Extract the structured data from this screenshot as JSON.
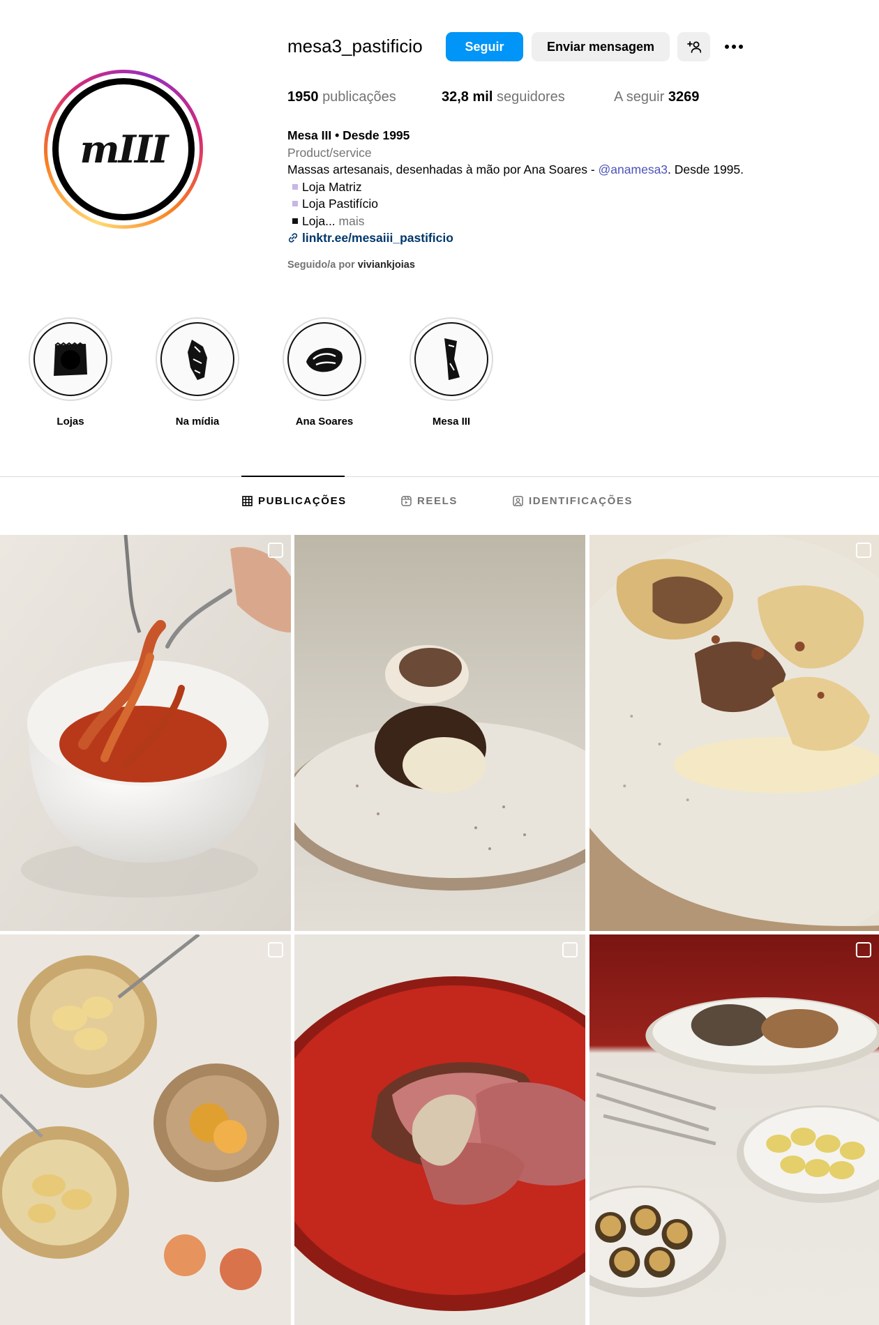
{
  "profile": {
    "username": "mesa3_pastificio",
    "avatar_text": "mIII",
    "follow_label": "Seguir",
    "message_label": "Enviar mensagem",
    "add_icon": "person-add-icon",
    "more_icon": "more-horizontal-icon"
  },
  "stats": {
    "posts_value": "1950",
    "posts_label": "publicações",
    "followers_value": "32,8 mil",
    "followers_label": "seguidores",
    "following_label": "A seguir",
    "following_value": "3269"
  },
  "bio": {
    "name": "Mesa III • Desde 1995",
    "category": "Product/service",
    "text_before": "Massas artesanais, desenhadas à mão por Ana Soares - ",
    "mention": "@anamesa3",
    "text_after": ". Desde 1995.",
    "line1": "Loja Matriz",
    "line2": "Loja Pastifício",
    "line3": "Loja...",
    "more": " mais",
    "link": "linktr.ee/mesaiii_pastificio",
    "followed_by_prefix": "Seguido/a por",
    "followed_by_user": "viviankjoias"
  },
  "highlights": [
    {
      "label": "Lojas"
    },
    {
      "label": "Na mídia"
    },
    {
      "label": "Ana Soares"
    },
    {
      "label": "Mesa III"
    }
  ],
  "tabs": [
    {
      "label": "PUBLICAÇÕES",
      "active": true,
      "icon": "grid-icon"
    },
    {
      "label": "REELS",
      "active": false,
      "icon": "reels-icon"
    },
    {
      "label": "IDENTIFICAÇÕES",
      "active": false,
      "icon": "tagged-icon"
    }
  ],
  "colors": {
    "follow_button": "#0095f6",
    "secondary_button": "#efefef",
    "mention": "#4b53b8",
    "link": "#00376b",
    "muted_text": "#737373"
  }
}
